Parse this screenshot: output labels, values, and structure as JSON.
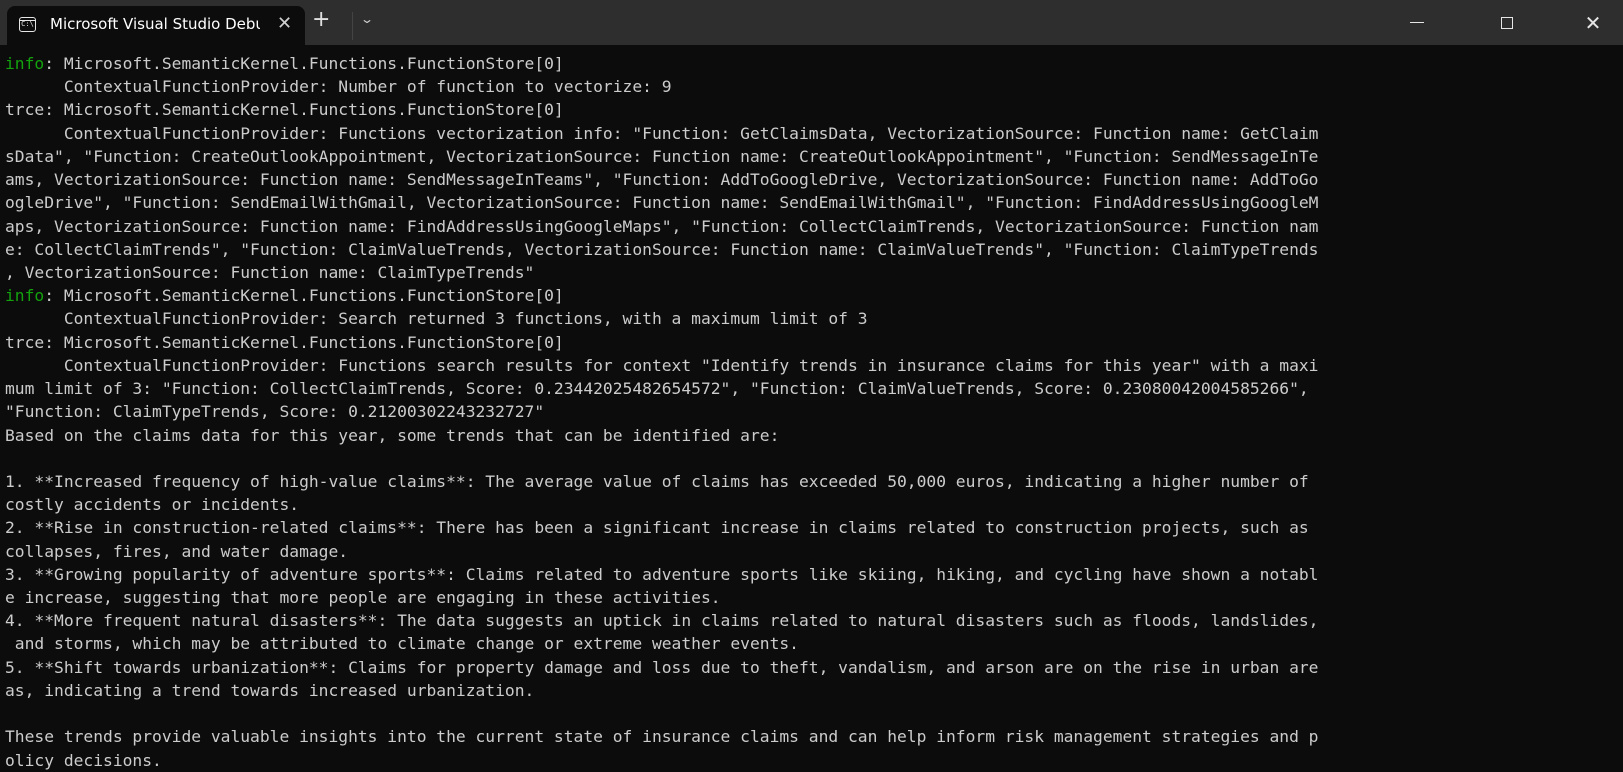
{
  "window": {
    "tab_title": "Microsoft Visual Studio Debug Console",
    "tab_icon": "console-icon",
    "new_tab_icon": "plus-icon",
    "dropdown_icon": "chevron-down-icon",
    "controls": [
      "minimize-icon",
      "maximize-icon",
      "close-icon"
    ]
  },
  "colors": {
    "background": "#0c0c0c",
    "text": "#cccccc",
    "info": "#13a10e",
    "titlebar": "#2e2e2e"
  },
  "console": {
    "lines": [
      {
        "level": "info",
        "text": ": Microsoft.SemanticKernel.Functions.FunctionStore[0]"
      },
      {
        "level": "",
        "text": "      ContextualFunctionProvider: Number of function to vectorize: 9"
      },
      {
        "level": "",
        "text": "trce: Microsoft.SemanticKernel.Functions.FunctionStore[0]"
      },
      {
        "level": "",
        "text": "      ContextualFunctionProvider: Functions vectorization info: \"Function: GetClaimsData, VectorizationSource: Function name: GetClaim"
      },
      {
        "level": "",
        "text": "sData\", \"Function: CreateOutlookAppointment, VectorizationSource: Function name: CreateOutlookAppointment\", \"Function: SendMessageInTe"
      },
      {
        "level": "",
        "text": "ams, VectorizationSource: Function name: SendMessageInTeams\", \"Function: AddToGoogleDrive, VectorizationSource: Function name: AddToGo"
      },
      {
        "level": "",
        "text": "ogleDrive\", \"Function: SendEmailWithGmail, VectorizationSource: Function name: SendEmailWithGmail\", \"Function: FindAddressUsingGoogleM"
      },
      {
        "level": "",
        "text": "aps, VectorizationSource: Function name: FindAddressUsingGoogleMaps\", \"Function: CollectClaimTrends, VectorizationSource: Function nam"
      },
      {
        "level": "",
        "text": "e: CollectClaimTrends\", \"Function: ClaimValueTrends, VectorizationSource: Function name: ClaimValueTrends\", \"Function: ClaimTypeTrends"
      },
      {
        "level": "",
        "text": ", VectorizationSource: Function name: ClaimTypeTrends\""
      },
      {
        "level": "info",
        "text": ": Microsoft.SemanticKernel.Functions.FunctionStore[0]"
      },
      {
        "level": "",
        "text": "      ContextualFunctionProvider: Search returned 3 functions, with a maximum limit of 3"
      },
      {
        "level": "",
        "text": "trce: Microsoft.SemanticKernel.Functions.FunctionStore[0]"
      },
      {
        "level": "",
        "text": "      ContextualFunctionProvider: Functions search results for context \"Identify trends in insurance claims for this year\" with a maxi"
      },
      {
        "level": "",
        "text": "mum limit of 3: \"Function: CollectClaimTrends, Score: 0.23442025482654572\", \"Function: ClaimValueTrends, Score: 0.23080042004585266\","
      },
      {
        "level": "",
        "text": "\"Function: ClaimTypeTrends, Score: 0.21200302243232727\""
      },
      {
        "level": "",
        "text": "Based on the claims data for this year, some trends that can be identified are:"
      },
      {
        "level": "",
        "text": ""
      },
      {
        "level": "",
        "text": "1. **Increased frequency of high-value claims**: The average value of claims has exceeded 50,000 euros, indicating a higher number of"
      },
      {
        "level": "",
        "text": "costly accidents or incidents."
      },
      {
        "level": "",
        "text": "2. **Rise in construction-related claims**: There has been a significant increase in claims related to construction projects, such as"
      },
      {
        "level": "",
        "text": "collapses, fires, and water damage."
      },
      {
        "level": "",
        "text": "3. **Growing popularity of adventure sports**: Claims related to adventure sports like skiing, hiking, and cycling have shown a notabl"
      },
      {
        "level": "",
        "text": "e increase, suggesting that more people are engaging in these activities."
      },
      {
        "level": "",
        "text": "4. **More frequent natural disasters**: The data suggests an uptick in claims related to natural disasters such as floods, landslides,"
      },
      {
        "level": "",
        "text": " and storms, which may be attributed to climate change or extreme weather events."
      },
      {
        "level": "",
        "text": "5. **Shift towards urbanization**: Claims for property damage and loss due to theft, vandalism, and arson are on the rise in urban are"
      },
      {
        "level": "",
        "text": "as, indicating a trend towards increased urbanization."
      },
      {
        "level": "",
        "text": ""
      },
      {
        "level": "",
        "text": "These trends provide valuable insights into the current state of insurance claims and can help inform risk management strategies and p"
      },
      {
        "level": "",
        "text": "olicy decisions."
      }
    ]
  }
}
